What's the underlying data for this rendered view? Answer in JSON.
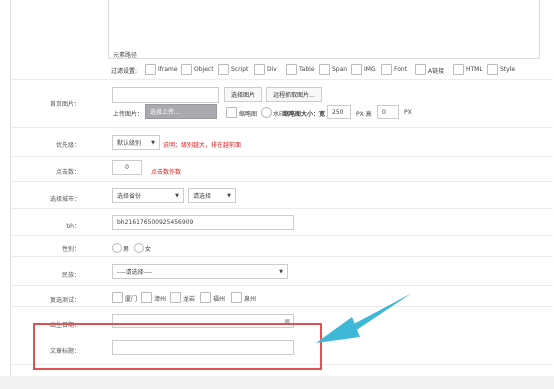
{
  "editor": {
    "element_path": "元素路径",
    "filter_label": "过滤设置:",
    "filters": [
      "Iframe",
      "Object",
      "Script",
      "Div",
      "Table",
      "Span",
      "IMG",
      "Font",
      "A链接",
      "HTML",
      "Style"
    ]
  },
  "cover": {
    "label": "首页图片：",
    "select_btn": "选择图片",
    "remote_btn": "远程抓取图片...",
    "upload_label": "上传图片：",
    "upload_btn": "选择上传...",
    "thumb_label": "缩略图",
    "water_label": "水印",
    "thumb_size_label": "缩略图大小：宽",
    "width_value": "250",
    "px_height": "PX 高",
    "height_value": "0",
    "px": "PX"
  },
  "priority": {
    "label": "优先级：",
    "value": "默认级别",
    "hint": "说明：级别越大，排在越前面"
  },
  "clicks": {
    "label": "点击数：",
    "value": "0",
    "hint": "点击数作数"
  },
  "city": {
    "label": "选择城市：",
    "province": "选择省份",
    "city": "请选择"
  },
  "bh": {
    "label": "bh：",
    "value": "bh216176500925456909"
  },
  "gender": {
    "label": "性别：",
    "options": [
      "男",
      "女"
    ]
  },
  "nation": {
    "label": "民族：",
    "value": "----请选择----"
  },
  "multi": {
    "label": "复选测试：",
    "options": [
      "厦门",
      "漳州",
      "龙岩",
      "福州",
      "泉州"
    ]
  },
  "birth": {
    "label": "出生日期：",
    "value": ""
  },
  "article_title": {
    "label": "文章标题：",
    "value": ""
  },
  "colors": {
    "highlight": "#e25252",
    "arrow": "#3fb8d8",
    "hint": "#e02020"
  }
}
